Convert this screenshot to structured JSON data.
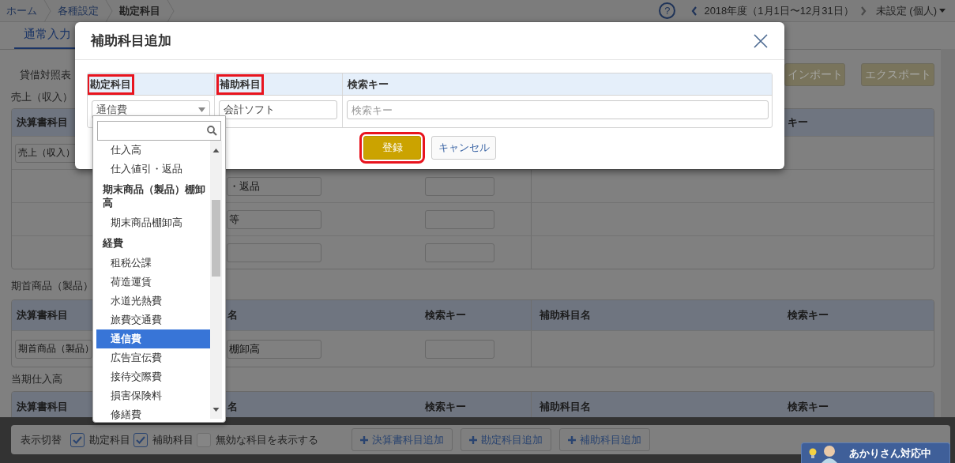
{
  "breadcrumbs": [
    {
      "label": "ホーム",
      "current": false
    },
    {
      "label": "各種設定",
      "current": false
    },
    {
      "label": "勘定科目",
      "current": true
    }
  ],
  "help_label": "?",
  "fiscal_year": "2018年度（1月1日〜12月31日）",
  "user": "未設定 (個人)",
  "tabs": [
    {
      "label": "通常入力",
      "selected": true
    }
  ],
  "sub_tab": "貸借対照表",
  "actions": [
    "インポート",
    "エクスポート"
  ],
  "sections": [
    {
      "title": "売上（収入）",
      "headers": {
        "column_1": "決算書科目",
        "column_5": "キー"
      },
      "rows": [
        {
          "column_1": {
            "kind": "input",
            "value": "売上（収入）"
          }
        },
        {
          "column_2": {
            "kind": "input",
            "value": "・返品"
          },
          "column_3": {
            "kind": "input"
          }
        },
        {
          "column_2": {
            "kind": "input",
            "value": "等"
          },
          "column_3": {
            "kind": "input"
          }
        },
        {
          "column_2": {
            "kind": "input"
          },
          "column_3": {
            "kind": "input"
          }
        }
      ]
    },
    {
      "title": "期首商品（製品）",
      "headers": {
        "column_1": "決算書科目",
        "column_2": "名",
        "column_3": "検索キー",
        "column_4": "補助科目名",
        "column_5": "検索キー"
      },
      "rows": [
        {
          "column_1": {
            "kind": "input",
            "value": "期首商品（製品）"
          },
          "column_2": {
            "kind": "input",
            "value": "棚卸高"
          },
          "column_3": {
            "kind": "input"
          }
        }
      ]
    },
    {
      "title": "当期仕入高",
      "headers": {
        "column_1": "決算書科目",
        "column_2": "名",
        "column_3": "検索キー",
        "column_4": "補助科目名",
        "column_5": "検索キー"
      },
      "rows": [
        {}
      ]
    }
  ],
  "modal": {
    "title": "補助科目追加",
    "headers": [
      {
        "label": "勘定科目",
        "highlighted": true
      },
      {
        "label": "補助科目",
        "highlighted": true
      },
      {
        "label": "検索キー",
        "highlighted": false
      }
    ],
    "fields": [
      {
        "kind": "select",
        "value": "通信費"
      },
      {
        "kind": "input",
        "value": "会計ソフト"
      },
      {
        "kind": "input",
        "placeholder": "検索キー"
      }
    ],
    "buttons": [
      {
        "label": "登録",
        "kind": "primary",
        "highlighted": true
      },
      {
        "label": "キャンセル",
        "kind": "secondary",
        "highlighted": false
      }
    ]
  },
  "dropdown": {
    "items": [
      {
        "label": "仕入高",
        "kind": "option",
        "selected": false
      },
      {
        "label": "仕入値引・返品",
        "kind": "option",
        "selected": false
      },
      {
        "label": "期末商品（製品）棚卸高",
        "kind": "group",
        "selected": false
      },
      {
        "label": "期末商品棚卸高",
        "kind": "option",
        "selected": false
      },
      {
        "label": "経費",
        "kind": "group",
        "selected": false
      },
      {
        "label": "租税公課",
        "kind": "option",
        "selected": false
      },
      {
        "label": "荷造運賃",
        "kind": "option",
        "selected": false
      },
      {
        "label": "水道光熱費",
        "kind": "option",
        "selected": false
      },
      {
        "label": "旅費交通費",
        "kind": "option",
        "selected": false
      },
      {
        "label": "通信費",
        "kind": "option",
        "selected": true
      },
      {
        "label": "広告宣伝費",
        "kind": "option",
        "selected": false
      },
      {
        "label": "接待交際費",
        "kind": "option",
        "selected": false
      },
      {
        "label": "損害保険料",
        "kind": "option",
        "selected": false
      },
      {
        "label": "修繕費",
        "kind": "option",
        "selected": false
      }
    ]
  },
  "bottom_bar": {
    "label": "表示切替",
    "toggles": [
      {
        "label": "勘定科目",
        "checked": true
      },
      {
        "label": "補助科目",
        "checked": true
      },
      {
        "label": "無効な科目を表示する",
        "checked": false
      }
    ],
    "buttons": [
      "決算書科目追加",
      "勘定科目追加",
      "補助科目追加"
    ]
  },
  "chat_badge": "あかりさん対応中"
}
